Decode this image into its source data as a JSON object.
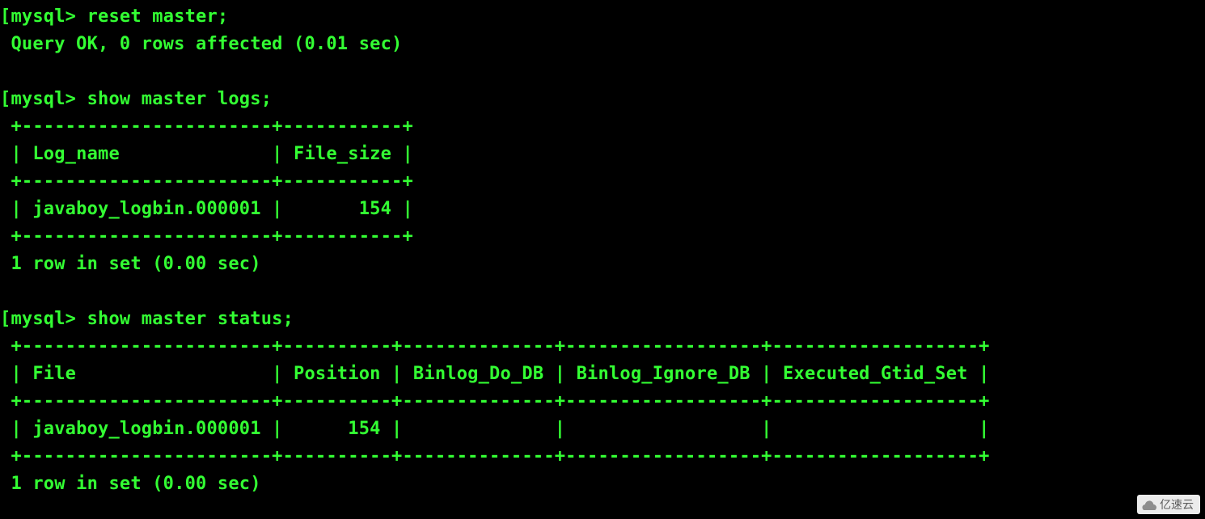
{
  "prompt": "mysql>",
  "bracket": "[",
  "commands": {
    "reset_master": "reset master;",
    "show_master_logs": "show master logs;",
    "show_master_status": "show master status;"
  },
  "messages": {
    "query_ok": "Query OK, 0 rows affected (0.01 sec)",
    "rows_in_set_1": "1 row in set (0.00 sec)",
    "rows_in_set_2": "1 row in set (0.00 sec)"
  },
  "table1": {
    "border_top": "+-----------------------+-----------+",
    "header": "| Log_name              | File_size |",
    "border_mid": "+-----------------------+-----------+",
    "row": "| javaboy_logbin.000001 |       154 |",
    "border_bot": "+-----------------------+-----------+",
    "data": {
      "columns": [
        "Log_name",
        "File_size"
      ],
      "rows": [
        {
          "Log_name": "javaboy_logbin.000001",
          "File_size": 154
        }
      ]
    }
  },
  "table2": {
    "border_top": "+-----------------------+----------+--------------+------------------+-------------------+",
    "header": "| File                  | Position | Binlog_Do_DB | Binlog_Ignore_DB | Executed_Gtid_Set |",
    "border_mid": "+-----------------------+----------+--------------+------------------+-------------------+",
    "row": "| javaboy_logbin.000001 |      154 |              |                  |                   |",
    "border_bot": "+-----------------------+----------+--------------+------------------+-------------------+",
    "data": {
      "columns": [
        "File",
        "Position",
        "Binlog_Do_DB",
        "Binlog_Ignore_DB",
        "Executed_Gtid_Set"
      ],
      "rows": [
        {
          "File": "javaboy_logbin.000001",
          "Position": 154,
          "Binlog_Do_DB": "",
          "Binlog_Ignore_DB": "",
          "Executed_Gtid_Set": ""
        }
      ]
    }
  },
  "watermark": "亿速云"
}
